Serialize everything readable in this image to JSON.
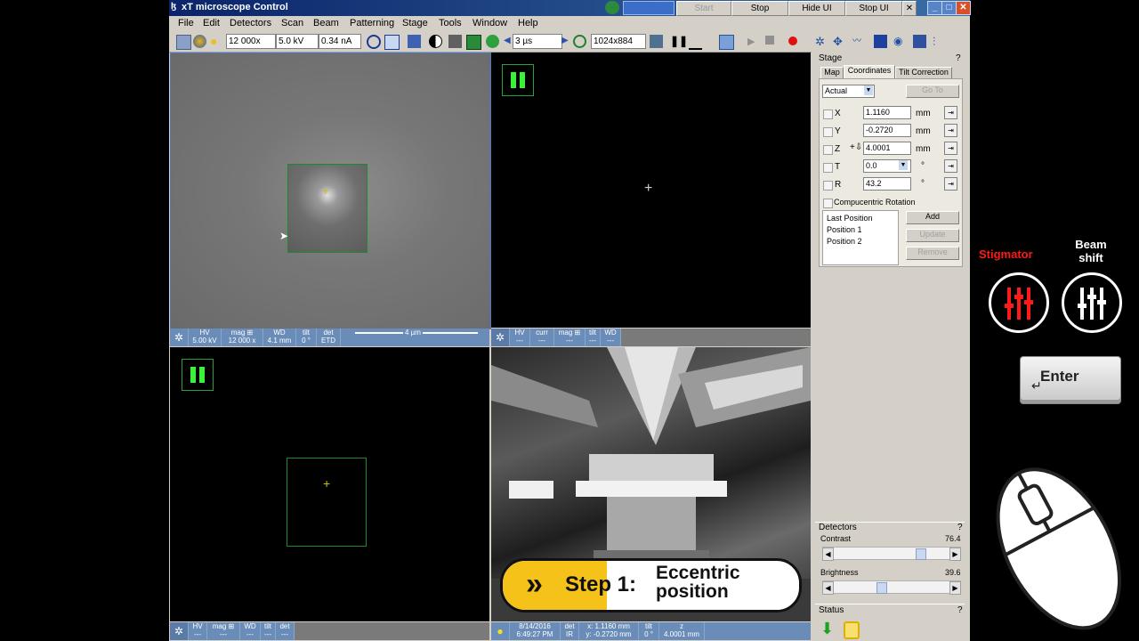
{
  "window": {
    "title": "xT microscope Control",
    "buttons": {
      "start": "Start",
      "stop": "Stop",
      "hide_ui": "Hide UI",
      "stop_ui": "Stop UI",
      "close": "✕"
    }
  },
  "menu": [
    "File",
    "Edit",
    "Detectors",
    "Scan",
    "Beam",
    "Patterning",
    "Stage",
    "Tools",
    "Window",
    "Help"
  ],
  "toolbar": {
    "magnification": "12 000x",
    "voltage": "5.0 kV",
    "current": "0.34 nA",
    "dwell": "3 µs",
    "resolution": "1024x884"
  },
  "quad1": {
    "status": {
      "hv_label": "HV",
      "hv": "5.00 kV",
      "mag_label": "mag ⊞",
      "mag": "12 000 x",
      "wd_label": "WD",
      "wd": "4.1 mm",
      "tilt_label": "tilt",
      "tilt": "0 °",
      "det_label": "det",
      "det": "ETD",
      "scale": "4 µm"
    }
  },
  "quad2": {
    "status": {
      "hv_label": "HV",
      "hv": "---",
      "curr_label": "curr",
      "curr": "---",
      "mag_label": "mag ⊞",
      "mag": "---",
      "tilt_label": "tilt",
      "tilt": "---",
      "wd_label": "WD",
      "wd": "---"
    }
  },
  "quad3": {
    "status": {
      "hv_label": "HV",
      "hv": "---",
      "mag_label": "mag ⊞",
      "mag": "---",
      "wd_label": "WD",
      "wd": "---",
      "tilt_label": "tilt",
      "tilt": "---",
      "det_label": "det",
      "det": "---"
    }
  },
  "quad4": {
    "status": {
      "date": "8/14/2016",
      "time": "6:49:27 PM",
      "det_label": "det",
      "det": "IR",
      "x": "x: 1.1160 mm",
      "y": "y: -0.2720 mm",
      "tilt_label": "tilt",
      "tilt": "0 °",
      "z_label": "z",
      "z": "4.0001 mm"
    }
  },
  "stage": {
    "title": "Stage",
    "help": "?",
    "tabs": [
      "Map",
      "Coordinates",
      "Tilt Correction"
    ],
    "mode": "Actual",
    "goto": "Go To",
    "coords": [
      {
        "axis": "X",
        "value": "1.1160",
        "unit": "mm"
      },
      {
        "axis": "Y",
        "value": "-0.2720",
        "unit": "mm"
      },
      {
        "axis": "Z",
        "value": "4.0001",
        "unit": "mm"
      },
      {
        "axis": "T",
        "value": "0.0",
        "unit": "°"
      },
      {
        "axis": "R",
        "value": "43.2",
        "unit": "°"
      }
    ],
    "compucentric": "Compucentric Rotation",
    "positions": [
      "Last Position",
      "Position 1",
      "Position 2"
    ],
    "add": "Add",
    "update": "Update",
    "remove": "Remove"
  },
  "detectors": {
    "title": "Detectors",
    "help": "?",
    "contrast_label": "Contrast",
    "contrast": "76.4",
    "brightness_label": "Brightness",
    "brightness": "39.6"
  },
  "status_panel": {
    "title": "Status",
    "help": "?"
  },
  "overlay": {
    "step_label": "Step 1:",
    "step_title_line1": "Eccentric",
    "step_title_line2": "position",
    "stigmator": "Stigmator",
    "beam_shift_line1": "Beam",
    "beam_shift_line2": "shift",
    "enter": "Enter"
  },
  "colors": {
    "accent": "#ff1a1a",
    "step_yellow": "#f5c21a",
    "title_blue": "#0a246a",
    "status_blue": "#6a8cb8"
  }
}
